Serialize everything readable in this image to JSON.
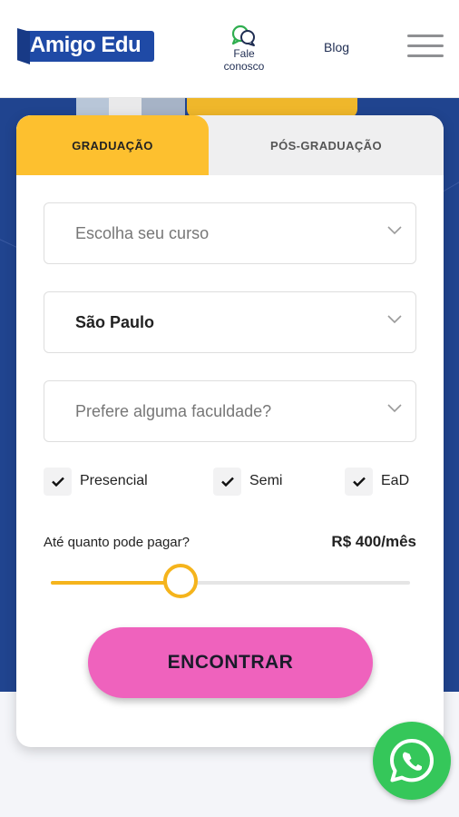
{
  "header": {
    "logo_text": "Amigo Edu",
    "contact_label_line1": "Fale",
    "contact_label_line2": "conosco",
    "blog_label": "Blog",
    "menu_icon": "hamburger-icon"
  },
  "tabs": [
    {
      "label": "GRADUAÇÃO",
      "active": true
    },
    {
      "label": "PÓS-GRADUAÇÃO",
      "active": false
    }
  ],
  "form": {
    "course_placeholder": "Escolha seu curso",
    "city_value": "São Paulo",
    "college_placeholder": "Prefere alguma faculdade?",
    "modalities": [
      {
        "label": "Presencial",
        "checked": true
      },
      {
        "label": "Semi",
        "checked": true
      },
      {
        "label": "EaD",
        "checked": true
      }
    ],
    "price_label": "Até quanto pode pagar?",
    "price_value": "R$ 400/mês",
    "price_fraction": 0.36,
    "submit_label": "ENCONTRAR"
  },
  "colors": {
    "brand_blue": "#1f4aa6",
    "hero_blue": "#20448f",
    "tab_yellow": "#fdc02f",
    "slider_yellow": "#f5b41c",
    "cta_pink": "#ef62bd",
    "whatsapp_green": "#35c75a"
  },
  "floating": {
    "whatsapp_icon": "whatsapp-icon"
  }
}
